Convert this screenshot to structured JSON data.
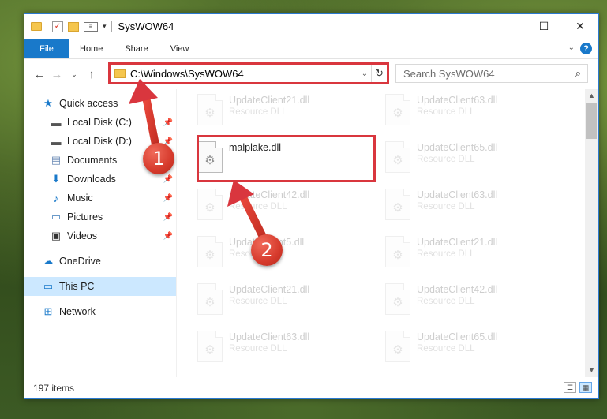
{
  "window": {
    "title": "SysWOW64"
  },
  "controls": {
    "minimize": "—",
    "maximize": "☐",
    "close": "✕"
  },
  "ribbon": {
    "tabs": [
      "File",
      "Home",
      "Share",
      "View"
    ],
    "help": "?"
  },
  "address": {
    "path": "C:\\Windows\\SysWOW64"
  },
  "search": {
    "placeholder": "Search SysWOW64"
  },
  "sidebar": {
    "items": [
      {
        "label": "Quick access",
        "icon": "star-icon"
      },
      {
        "label": "Local Disk (C:)",
        "icon": "drive-icon",
        "pinned": true
      },
      {
        "label": "Local Disk (D:)",
        "icon": "drive-icon",
        "pinned": true
      },
      {
        "label": "Documents",
        "icon": "documents-icon",
        "pinned": true
      },
      {
        "label": "Downloads",
        "icon": "download-icon",
        "pinned": true
      },
      {
        "label": "Music",
        "icon": "music-icon",
        "pinned": true
      },
      {
        "label": "Pictures",
        "icon": "pictures-icon",
        "pinned": true
      },
      {
        "label": "Videos",
        "icon": "videos-icon",
        "pinned": true
      },
      {
        "label": "OneDrive",
        "icon": "cloud-icon"
      },
      {
        "label": "This PC",
        "icon": "pc-icon",
        "selected": true
      },
      {
        "label": "Network",
        "icon": "network-icon"
      }
    ]
  },
  "files": {
    "left": [
      {
        "name": "UpdateClient21.dll",
        "type": "Resource DLL",
        "faded": true
      },
      {
        "name": "malplake.dll",
        "type": "",
        "faded": false
      },
      {
        "name": "UpdateClient42.dll",
        "type": "Resource DLL",
        "faded": true
      },
      {
        "name": "UpdateClient5.dll",
        "type": "Resource DLL",
        "faded": true
      },
      {
        "name": "UpdateClient21.dll",
        "type": "Resource DLL",
        "faded": true
      },
      {
        "name": "UpdateClient63.dll",
        "type": "Resource DLL",
        "faded": true
      }
    ],
    "right": [
      {
        "name": "UpdateClient63.dll",
        "type": "Resource DLL",
        "faded": true
      },
      {
        "name": "UpdateClient65.dll",
        "type": "Resource DLL",
        "faded": true
      },
      {
        "name": "UpdateClient63.dll",
        "type": "Resource DLL",
        "faded": true
      },
      {
        "name": "UpdateClient21.dll",
        "type": "Resource DLL",
        "faded": true
      },
      {
        "name": "UpdateClient42.dll",
        "type": "Resource DLL",
        "faded": true
      },
      {
        "name": "UpdateClient65.dll",
        "type": "Resource DLL",
        "faded": true
      }
    ]
  },
  "status": {
    "count": "197 items"
  },
  "annotations": {
    "step1": "1",
    "step2": "2",
    "color": "#d9363e"
  }
}
